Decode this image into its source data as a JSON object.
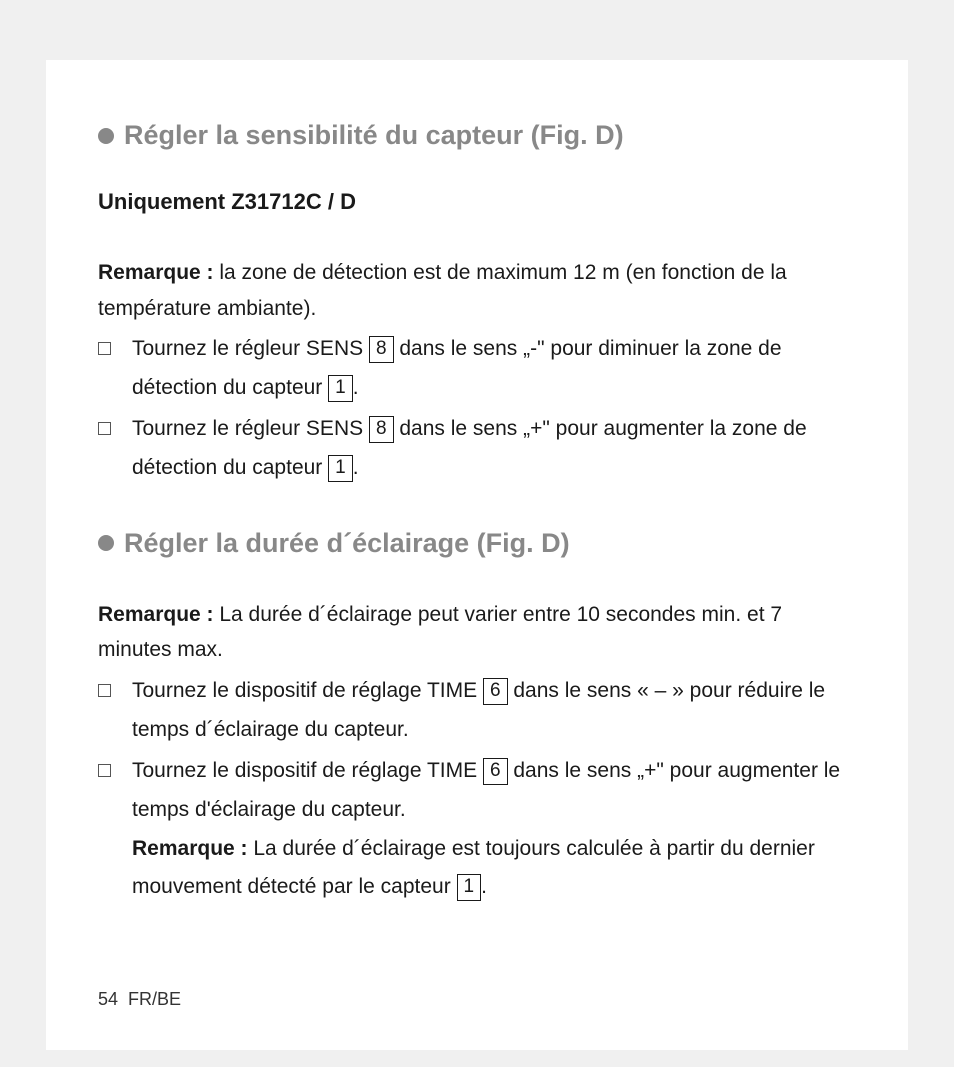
{
  "section1": {
    "heading": "Régler la sensibilité du capteur (Fig. D)",
    "subheading": "Uniquement Z31712C / D",
    "note_label": "Remarque :",
    "note_text": " la zone de détection est de maximum 12 m (en fonction de la température ambiante).",
    "item1_a": "Tournez le régleur SENS ",
    "item1_ref1": "8",
    "item1_b": " dans le sens „-\" pour diminuer la zone de détection du capteur ",
    "item1_ref2": "1",
    "item1_c": ".",
    "item2_a": "Tournez le régleur SENS ",
    "item2_ref1": "8",
    "item2_b": " dans le sens „+\" pour augmenter la zone de détection du capteur ",
    "item2_ref2": "1",
    "item2_c": "."
  },
  "section2": {
    "heading": "Régler la durée d´éclairage (Fig. D)",
    "note_label": "Remarque :",
    "note_text": " La durée d´éclairage peut varier entre 10 secondes min. et 7 minutes max.",
    "item1_a": "Tournez le dispositif de réglage TIME ",
    "item1_ref1": "6",
    "item1_b": " dans le sens « – » pour réduire le temps d´éclairage du capteur.",
    "item2_a": "Tournez le dispositif de réglage TIME ",
    "item2_ref1": "6",
    "item2_b": " dans le sens „+\" pour augmenter le temps d'éclairage du capteur.",
    "item2_note_label": "Remarque :",
    "item2_note_a": " La durée d´éclairage est toujours calculée à partir du dernier mouvement détecté par le capteur ",
    "item2_note_ref": "1",
    "item2_note_b": "."
  },
  "footer": {
    "page": "54",
    "lang": "FR/BE"
  }
}
